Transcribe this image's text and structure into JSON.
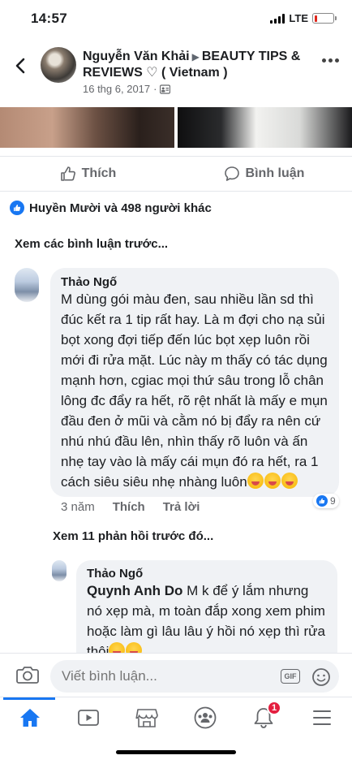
{
  "status_bar": {
    "time": "14:57",
    "network": "LTE",
    "battery_level": 0.15,
    "colors": {
      "battery_low": "#e0261b"
    }
  },
  "header": {
    "author": "Nguyễn Văn Khải",
    "group": "BEAUTY TIPS & REVIEWS ♡ ( Vietnam )",
    "date": "16 thg 6, 2017",
    "icons": [
      "back-icon",
      "group-icon",
      "more-icon"
    ]
  },
  "actions": {
    "like_label": "Thích",
    "comment_label": "Bình luận"
  },
  "reactions": {
    "summary": "Huyền Mười và 498 người khác"
  },
  "comments_section": {
    "view_previous_label": "Xem các bình luận trước...",
    "view_replies_label": "Xem 11 phản hồi trước đó...",
    "comments": [
      {
        "author": "Thảo Ngố",
        "text": "M dùng gói màu đen, sau nhiều lần sd thì đúc kết ra 1 tip rất hay. Là m đợi cho nạ sủi bọt xong đợi tiếp đến lúc bọt xẹp luôn rồi mới đi rửa mặt. Lúc này m thấy có tác dụng mạnh hơn, cgiac mọi thứ sâu trong lỗ chân lông đc đẩy ra hết, rõ rệt nhất là mấy e mụn đầu đen ở mũi và cằm nó bị đẩy ra nên cứ nhú nhú đầu lên, nhìn thấy rõ luôn và ấn nhẹ tay vào là mấy cái mụn đó ra hết, ra 1 cách siêu siêu nhẹ nhàng luôn",
        "emoji_count": 3,
        "time": "3 năm",
        "like_label": "Thích",
        "reply_label": "Trả lời",
        "likes": "9"
      },
      {
        "author": "Thảo Ngố",
        "mention": "Quynh Anh Do",
        "text": " M k để ý lắm nhưng nó xẹp mà, m toàn đắp xong xem phim hoặc làm gì lâu lâu ý hồi nó xẹp thì rửa thôi",
        "emoji_count": 2
      }
    ]
  },
  "composer": {
    "placeholder": "Viết bình luận...",
    "gif_label": "GIF"
  },
  "tab_bar": {
    "tabs": [
      "home",
      "watch",
      "marketplace",
      "groups",
      "notifications",
      "menu"
    ],
    "active": "home",
    "notification_count": "1",
    "colors": {
      "accent": "#1877f2",
      "badge": "#e41e3f"
    }
  }
}
